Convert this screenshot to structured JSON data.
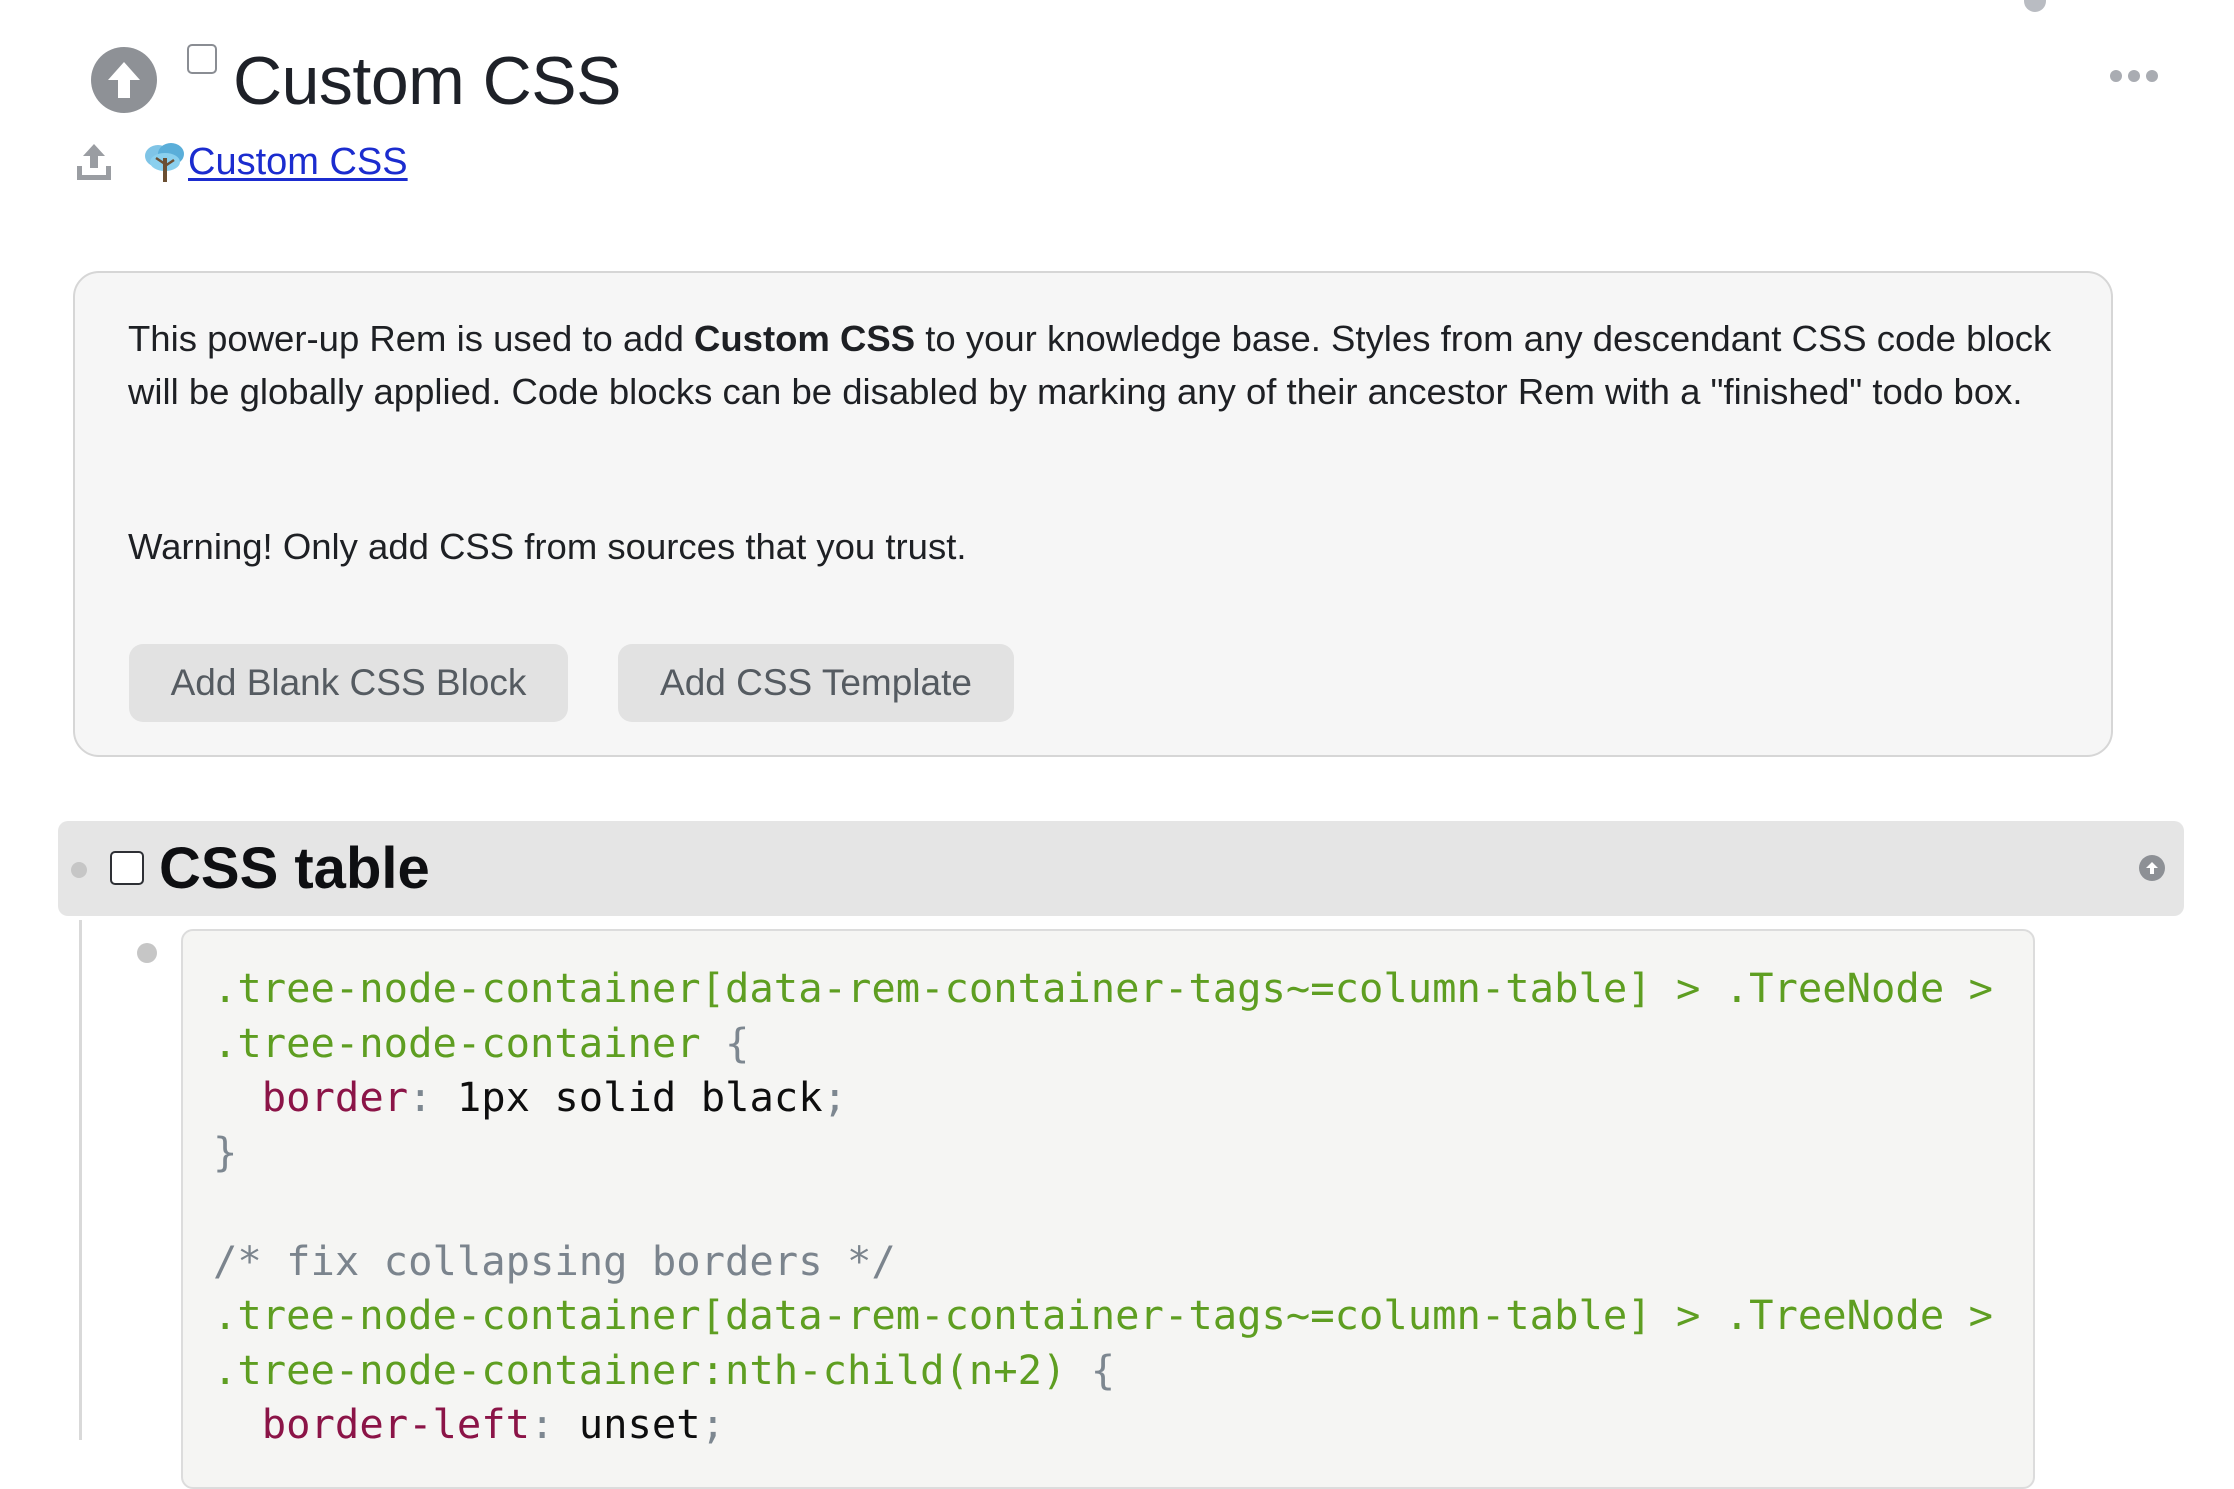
{
  "page": {
    "title": "Custom CSS",
    "breadcrumb_label": "Custom CSS"
  },
  "info": {
    "text_before": "This power-up Rem is used to add ",
    "text_bold": "Custom CSS",
    "text_after": " to your knowledge base. Styles from any descendant CSS code block will be globally applied. Code blocks can be disabled by marking any of their ancestor Rem with a \"finished\" todo box.",
    "warning": "Warning! Only add CSS from sources that you trust.",
    "add_blank_label": "Add Blank CSS Block",
    "add_template_label": "Add CSS Template"
  },
  "css_table": {
    "title": "CSS table"
  },
  "code": {
    "l1": ".tree-node-container[data-rem-container-tags~=column-table] > .TreeNode >",
    "l2_sel": ".tree-node-container",
    "l2_brace": " {",
    "l3_prop": "border",
    "l3_colon": ":",
    "l3_val": " 1px solid black",
    "l3_semi": ";",
    "l4": "}",
    "l6": "/* fix collapsing borders */",
    "l7": ".tree-node-container[data-rem-container-tags~=column-table] > .TreeNode >",
    "l8_sel": ".tree-node-container:nth-child(n+2)",
    "l8_brace": " {",
    "l9_prop": "border-left",
    "l9_colon": ":",
    "l9_val": " unset",
    "l9_semi": ";"
  },
  "icons": {
    "page_up": "arrow-up-circle-icon",
    "more": "more-horizontal-icon",
    "export": "upload-icon",
    "tree": "tree-icon",
    "row_up": "arrow-up-circle-small-icon"
  },
  "colors": {
    "link": "#1b2ccf",
    "selector": "#5e9e21",
    "property": "#8b1447",
    "comment": "#7b848d"
  }
}
